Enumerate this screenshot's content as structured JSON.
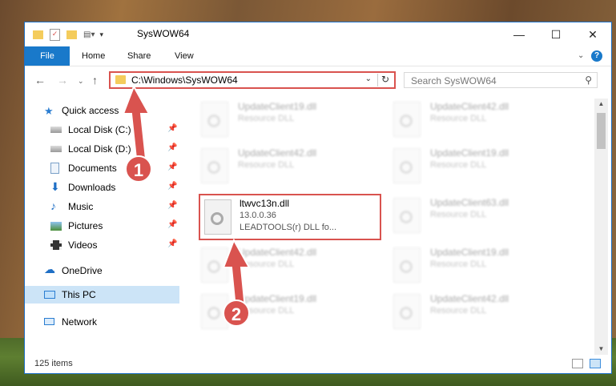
{
  "window": {
    "title": "SysWOW64"
  },
  "ribbon": {
    "tabs": [
      {
        "label": "File"
      },
      {
        "label": "Home"
      },
      {
        "label": "Share"
      },
      {
        "label": "View"
      }
    ],
    "help_label": "?"
  },
  "nav": {
    "address_path": "C:\\Windows\\SysWOW64",
    "search_placeholder": "Search SysWOW64"
  },
  "sidebar": {
    "items": [
      {
        "label": "Quick access",
        "icon": "star-icon"
      },
      {
        "label": "Local Disk (C:)",
        "icon": "drive-icon",
        "pinned": true
      },
      {
        "label": "Local Disk (D:)",
        "icon": "drive-icon",
        "pinned": true
      },
      {
        "label": "Documents",
        "icon": "documents-icon",
        "pinned": true
      },
      {
        "label": "Downloads",
        "icon": "download-icon",
        "pinned": true
      },
      {
        "label": "Music",
        "icon": "music-icon",
        "pinned": true
      },
      {
        "label": "Pictures",
        "icon": "pictures-icon",
        "pinned": true
      },
      {
        "label": "Videos",
        "icon": "videos-icon",
        "pinned": true
      },
      {
        "label": "OneDrive",
        "icon": "cloud-icon"
      },
      {
        "label": "This PC",
        "icon": "computer-icon",
        "selected": true
      },
      {
        "label": "Network",
        "icon": "network-icon"
      }
    ]
  },
  "files": {
    "r1c1": {
      "name": "UpdateClient19.dll",
      "type": "Resource DLL"
    },
    "r1c2": {
      "name": "UpdateClient42.dll",
      "type": "Resource DLL"
    },
    "r2c1": {
      "name": "UpdateClient42.dll",
      "type": "Resource DLL"
    },
    "r2c2": {
      "name": "UpdateClient19.dll",
      "type": "Resource DLL"
    },
    "target": {
      "name": "ltwvc13n.dll",
      "version": "13.0.0.36",
      "desc": "LEADTOOLS(r) DLL fo..."
    },
    "r3c2": {
      "name": "UpdateClient63.dll",
      "type": "Resource DLL"
    },
    "r4c1": {
      "name": "UpdateClient42.dll",
      "type": "Resource DLL"
    },
    "r4c2": {
      "name": "UpdateClient19.dll",
      "type": "Resource DLL"
    },
    "r5c1": {
      "name": "UpdateClient19.dll",
      "type": "Resource DLL"
    },
    "r5c2": {
      "name": "UpdateClient42.dll",
      "type": "Resource DLL"
    }
  },
  "status": {
    "item_count": "125 items"
  },
  "annotations": {
    "step1": "1",
    "step2": "2",
    "color": "#d9534f"
  }
}
